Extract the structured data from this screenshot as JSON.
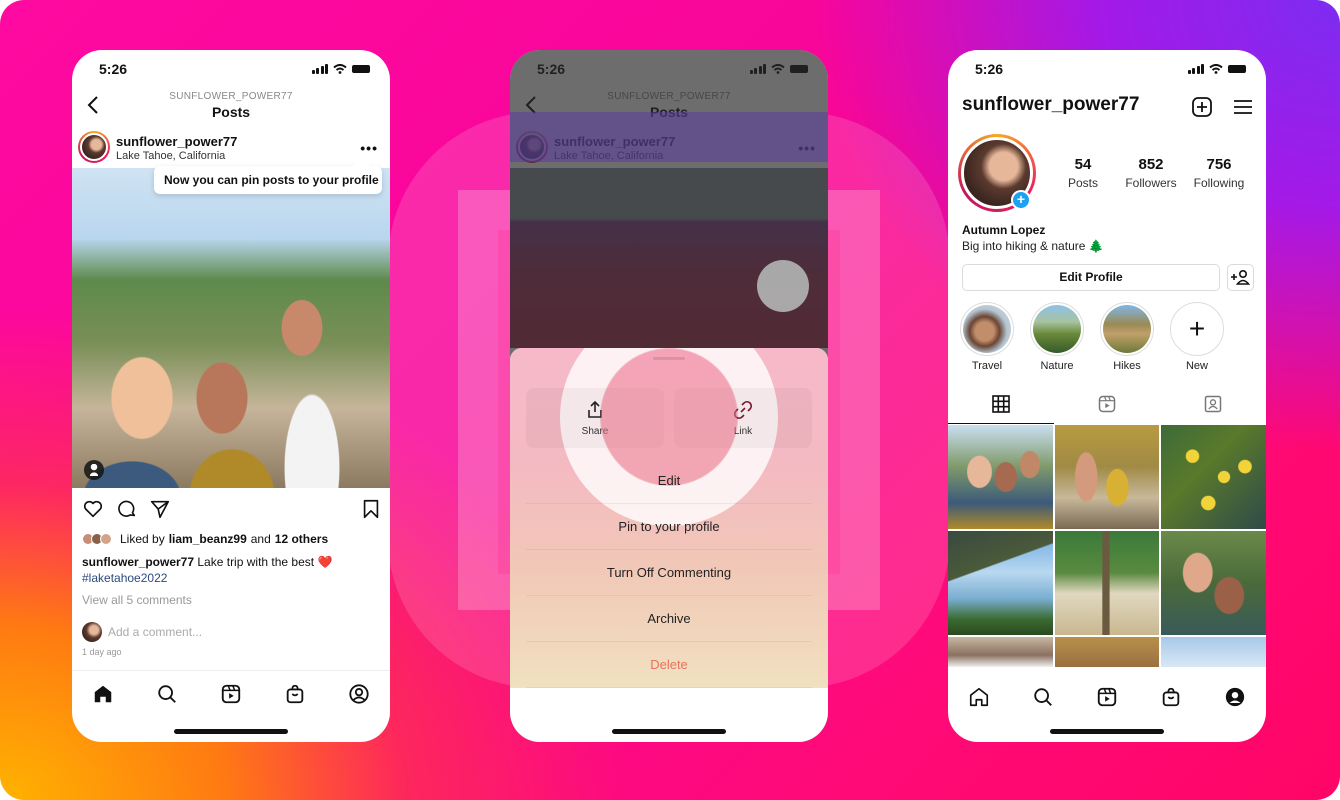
{
  "colors": {
    "accent_blue": "#1da1f2",
    "hashtag": "#2c4a7c",
    "danger": "#e8735f",
    "gradient_orange": "#ff7a12",
    "gradient_pink": "#ff0aa0",
    "gradient_purple": "#7d2cf2"
  },
  "status_bar": {
    "time": "5:26"
  },
  "left_phone": {
    "header": {
      "subtitle": "SUNFLOWER_POWER77",
      "title": "Posts"
    },
    "post": {
      "username": "sunflower_power77",
      "location": "Lake Tahoe, California",
      "tooltip": "Now you can pin posts to your profile",
      "liked_by_prefix": "Liked by",
      "liked_by_user": "liam_beanz99",
      "liked_by_and": "and",
      "liked_by_others": "12 others",
      "caption_user": "sunflower_power77",
      "caption_text": "Lake trip with the best ❤️",
      "hashtag": "#laketahoe2022",
      "view_comments": "View all 5 comments",
      "add_comment_placeholder": "Add a comment...",
      "time_ago": "1 day ago"
    },
    "tab_bar": [
      "home-icon",
      "search-icon",
      "reels-icon",
      "shop-icon",
      "profile-icon"
    ]
  },
  "middle_phone": {
    "header": {
      "subtitle": "SUNFLOWER_POWER77",
      "title": "Posts"
    },
    "post": {
      "username": "sunflower_power77",
      "location": "Lake Tahoe, California"
    },
    "sheet": {
      "quick_actions": [
        {
          "label": "Share",
          "icon": "share-icon"
        },
        {
          "label": "Link",
          "icon": "link-icon"
        }
      ],
      "items": [
        {
          "label": "Edit"
        },
        {
          "label": "Pin to your profile"
        },
        {
          "label": "Turn Off Commenting"
        },
        {
          "label": "Archive"
        },
        {
          "label": "Delete",
          "danger": true
        }
      ]
    }
  },
  "right_phone": {
    "username": "sunflower_power77",
    "stats": [
      {
        "value": "54",
        "label": "Posts"
      },
      {
        "value": "852",
        "label": "Followers"
      },
      {
        "value": "756",
        "label": "Following"
      }
    ],
    "name": "Autumn Lopez",
    "bio": "Big into hiking & nature 🌲",
    "edit_profile_label": "Edit Profile",
    "highlights": [
      {
        "label": "Travel"
      },
      {
        "label": "Nature"
      },
      {
        "label": "Hikes"
      },
      {
        "label": "New"
      }
    ],
    "grid_tabs": [
      "grid-icon",
      "reels-icon",
      "tagged-icon"
    ],
    "tab_bar": [
      "home-icon",
      "search-icon",
      "reels-icon",
      "shop-icon",
      "profile-icon"
    ]
  }
}
